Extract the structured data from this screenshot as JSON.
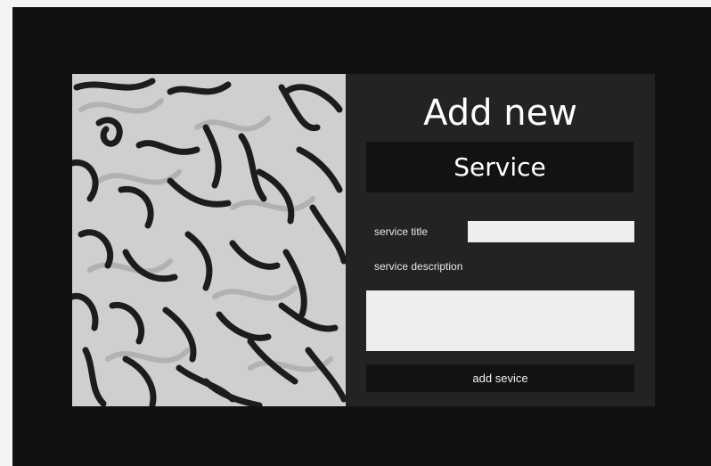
{
  "form": {
    "heading_line1": "Add new",
    "heading_line2": "Service",
    "service_title_label": "service title",
    "service_title_value": "",
    "service_description_label": "service description",
    "service_description_value": "",
    "submit_label": "add sevice"
  },
  "colors": {
    "page_background": "#111111",
    "card_background": "#232323",
    "band_background": "#121212",
    "input_background": "#eeeeee",
    "text": "#ffffff"
  }
}
